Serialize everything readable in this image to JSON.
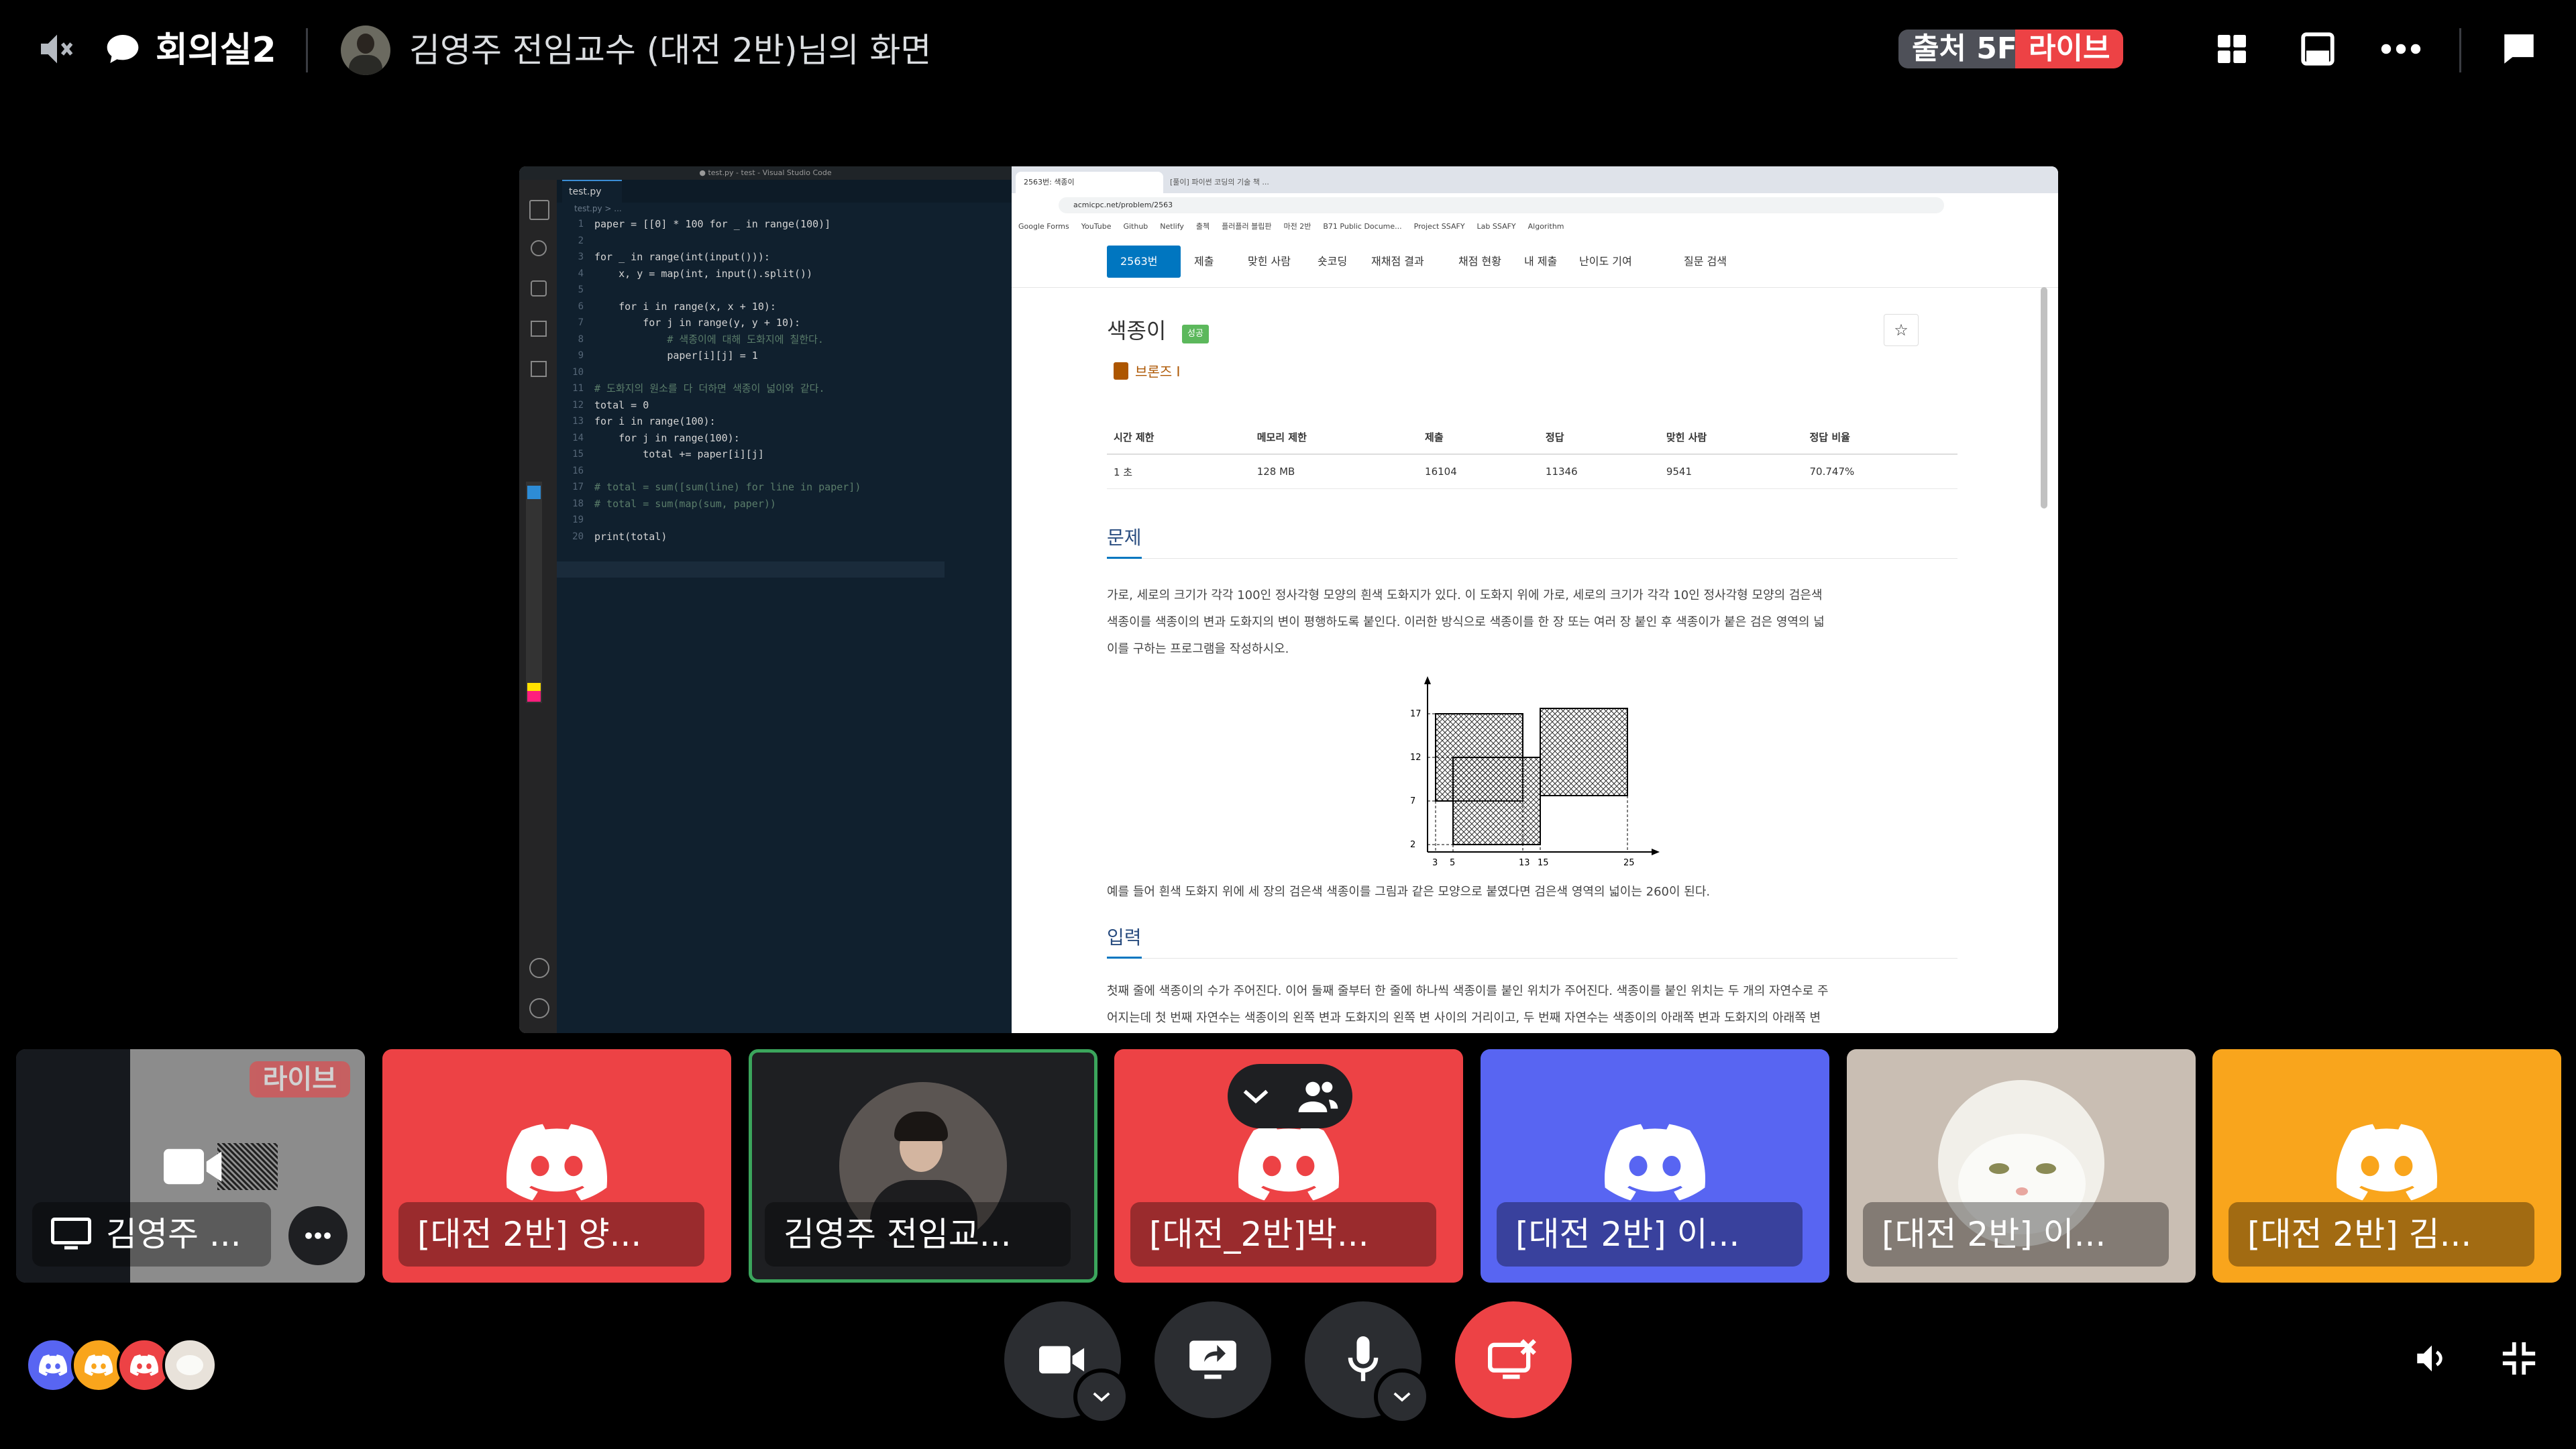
{
  "header": {
    "room_name": "회의실2",
    "screen_owner": "김영주 전임교수 (대전 2반)님의 화면",
    "fps_badge": "출처 5FPS",
    "live_badge": "라이브"
  },
  "shared_screen": {
    "vscode": {
      "title": "● test.py - test - Visual Studio Code",
      "tab": "test.py",
      "breadcrumb": "test.py > ...",
      "lines": [
        {
          "n": "1",
          "code": "paper = [[0] * 100 for _ in range(100)]"
        },
        {
          "n": "2",
          "code": ""
        },
        {
          "n": "3",
          "code": "for _ in range(int(input())):"
        },
        {
          "n": "4",
          "code": "    x, y = map(int, input().split())"
        },
        {
          "n": "5",
          "code": ""
        },
        {
          "n": "6",
          "code": "    for i in range(x, x + 10):"
        },
        {
          "n": "7",
          "code": "        for j in range(y, y + 10):"
        },
        {
          "n": "8",
          "code": "            # 색종이에 대해 도화지에 칠한다."
        },
        {
          "n": "9",
          "code": "            paper[i][j] = 1"
        },
        {
          "n": "10",
          "code": ""
        },
        {
          "n": "11",
          "code": "# 도화지의 원소를 다 더하면 색종이 넓이와 같다."
        },
        {
          "n": "12",
          "code": "total = 0"
        },
        {
          "n": "13",
          "code": "for i in range(100):"
        },
        {
          "n": "14",
          "code": "    for j in range(100):"
        },
        {
          "n": "15",
          "code": "        total += paper[i][j]"
        },
        {
          "n": "16",
          "code": ""
        },
        {
          "n": "17",
          "code": "# total = sum([sum(line) for line in paper])"
        },
        {
          "n": "18",
          "code": "# total = sum(map(sum, paper))"
        },
        {
          "n": "19",
          "code": ""
        },
        {
          "n": "20",
          "code": "print(total)"
        }
      ]
    },
    "browser": {
      "tab1": "2563번: 색종이",
      "tab2": "[풀이] 파이썬 코딩의 기술 책 ...",
      "url": "acmicpc.net/problem/2563",
      "bookmarks": [
        "Google Forms",
        "YouTube",
        "Github",
        "Netlify",
        "출첵",
        "플러플러 블립판",
        "마전 2반",
        "B71 Public Docume...",
        "Project SSAFY",
        "Lab SSAFY",
        "Algorithm"
      ],
      "nav": [
        "2563번",
        "제출",
        "맞힌 사람",
        "숏코딩",
        "재채점 결과",
        "채점 현황",
        "내 제출",
        "난이도 기여",
        "질문 검색"
      ],
      "problem_title": "색종이",
      "success_badge": "성공",
      "tier": "브론즈 I",
      "star": "☆",
      "table_headers": [
        "시간 제한",
        "메모리 제한",
        "제출",
        "정답",
        "맞힌 사람",
        "정답 비율"
      ],
      "table_values": [
        "1 초",
        "128 MB",
        "16104",
        "11346",
        "9541",
        "70.747%"
      ],
      "section_problem": "문제",
      "problem_text_1": "가로, 세로의 크기가 각각 100인 정사각형 모양의 흰색 도화지가 있다. 이 도화지 위에 가로, 세로의 크기가 각각 10인 정사각형 모양의 검은색",
      "problem_text_2": "색종이를 색종이의 변과 도화지의 변이 평행하도록 붙인다. 이러한 방식으로 색종이를 한 장 또는 여러 장 붙인 후 색종이가 붙은 검은 영역의 넓",
      "problem_text_3": "이를 구하는 프로그램을 작성하시오.",
      "figure_y_ticks": [
        "17",
        "12",
        "7",
        "2"
      ],
      "figure_x_ticks": [
        "3",
        "5",
        "13",
        "15",
        "25"
      ],
      "example_text": "예를 들어 흰색 도화지 위에 세 장의 검은색 색종이를 그림과 같은 모양으로 붙였다면 검은색 영역의 넓이는 260이 된다.",
      "section_input": "입력",
      "input_text_1": "첫째 줄에 색종이의 수가 주어진다. 이어 둘째 줄부터 한 줄에 하나씩 색종이를 붙인 위치가 주어진다. 색종이를 붙인 위치는 두 개의 자연수로 주",
      "input_text_2": "어지는데 첫 번째 자연수는 색종이의 왼쪽 변과 도화지의 왼쪽 변 사이의 거리이고, 두 번째 자연수는 색종이의 아래쪽 변과 도화지의 아래쪽 변"
    }
  },
  "tiles": [
    {
      "name": "김영주 ...",
      "live": "라이브",
      "color": "#2b2d31"
    },
    {
      "name": "[대전 2반] 양...",
      "color": "#ed4245"
    },
    {
      "name": "김영주 전임교...",
      "color": "#1e1f22"
    },
    {
      "name": "[대전_2반]박...",
      "color": "#ed4245"
    },
    {
      "name": "[대전 2반] 이...",
      "color": "#5865f2"
    },
    {
      "name": "[대전 2반] 이...",
      "color": "#c9beb3"
    },
    {
      "name": "[대전 2반] 김...",
      "color": "#f9a51c"
    }
  ],
  "colors": {
    "red": "#ed4245",
    "blurple": "#5865f2",
    "yellow": "#f9a51c",
    "green": "#3ba55c",
    "dark": "#2b2d31"
  }
}
